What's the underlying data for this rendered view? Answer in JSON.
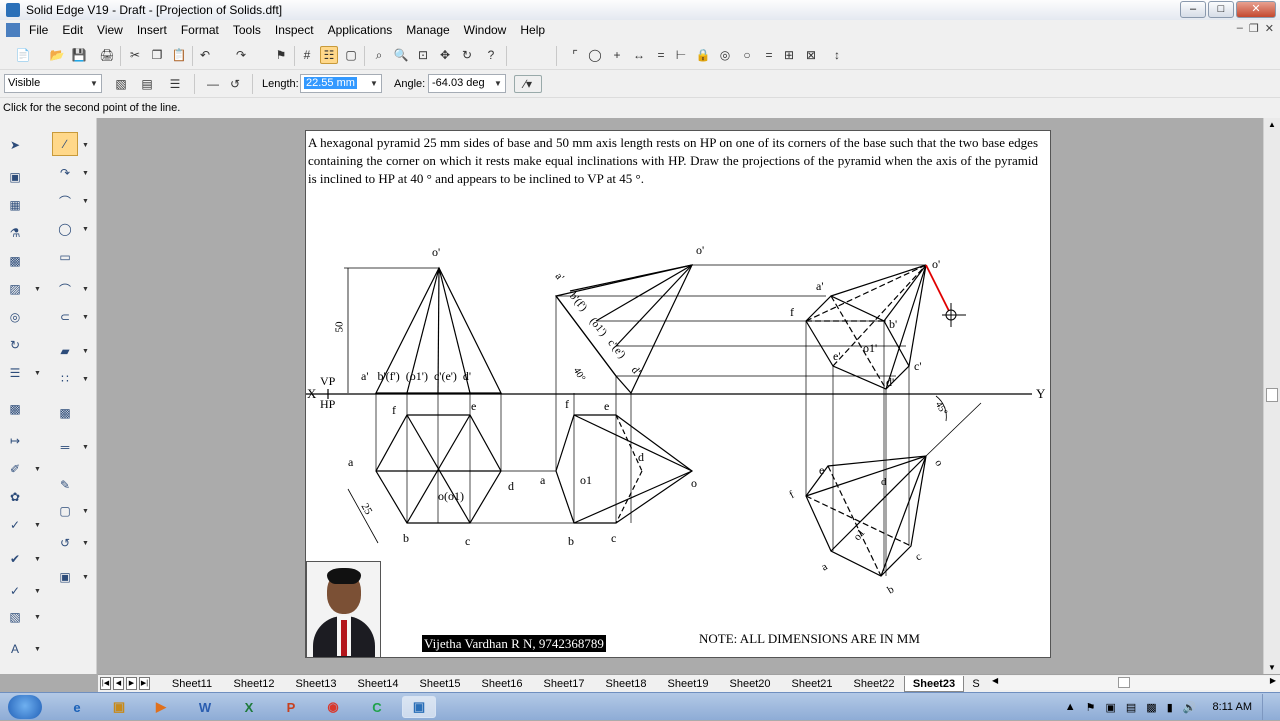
{
  "window": {
    "title": "Solid Edge V19 - Draft - [Projection of Solids.dft]"
  },
  "menu": [
    "File",
    "Edit",
    "View",
    "Insert",
    "Format",
    "Tools",
    "Inspect",
    "Applications",
    "Manage",
    "Window",
    "Help"
  ],
  "ribbon": {
    "style_value": "Visible",
    "length_label": "Length:",
    "length_value": "22.55 mm",
    "angle_label": "Angle:",
    "angle_value": "-64.03 deg"
  },
  "status": {
    "prompt": "Click for the second point of the line."
  },
  "sheet": {
    "problem_text": "A hexagonal pyramid 25 mm sides of base and 50 mm axis length rests on HP on one of its corners of the base such that the two base edges containing the corner on which it rests make equal inclinations with HP. Draw the projections of the pyramid when the axis of the pyramid is inclined to HP at 40 ° and appears to be inclined to VP at 45 °.",
    "author": "Vijetha Vardhan R N, 9742368789",
    "note": "NOTE: ALL DIMENSIONS ARE IN MM",
    "labels": {
      "x": "X",
      "y": "Y",
      "vp": "VP",
      "hp": "HP",
      "o_prime": "o'",
      "o_prime2": "o'",
      "o_prime3": "o'",
      "dim50": "50",
      "fv_row": "a'   b'(f')  (o1')  c'(e')  d'",
      "f": "f",
      "e": "e",
      "a": "a",
      "b": "b",
      "c": "c",
      "d": "d",
      "o_o1": "o(o1)",
      "dim25": "25",
      "f2": "f",
      "e2": "e",
      "a2": "a",
      "b2": "b",
      "c2": "c",
      "d2": "d",
      "o1_2": "o1",
      "o2": "o",
      "a_p2": "a'",
      "bf2": "b'(f')",
      "o1p2": "(o1')",
      "ce2": "c'(e')",
      "d_p2": "d'",
      "ang40": "40°",
      "a_p3": "a'",
      "f3": "f",
      "b_p3": "b'",
      "e_p3": "e'",
      "o1p3": "o1'",
      "c_p3": "c'",
      "d_p3": "d'",
      "e3": "e",
      "f3b": "f",
      "o1_3": "o1",
      "a3": "a",
      "b3": "b",
      "c3": "c",
      "d3": "d",
      "o3": "o",
      "ang45": "45°"
    }
  },
  "tabs": [
    "Sheet11",
    "Sheet12",
    "Sheet13",
    "Sheet14",
    "Sheet15",
    "Sheet16",
    "Sheet17",
    "Sheet18",
    "Sheet19",
    "Sheet20",
    "Sheet21",
    "Sheet22",
    "Sheet23",
    "S"
  ],
  "active_tab": "Sheet23",
  "taskbar": {
    "clock": "8:11 AM"
  }
}
